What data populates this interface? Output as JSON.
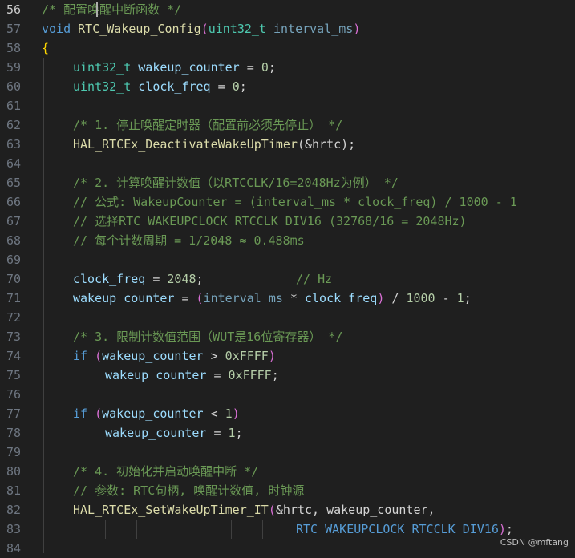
{
  "colors": {
    "background": "#1f1f1f",
    "line_number": "#6e7681",
    "comment": "#6a9955",
    "keyword": "#569cd6",
    "type": "#4ec9b0",
    "function": "#dcdcaa",
    "variable": "#9cdcfe",
    "number": "#b5cea8",
    "brace": "#ffd700",
    "paren": "#da70d6"
  },
  "line_numbers": [
    "56",
    "57",
    "58",
    "59",
    "60",
    "61",
    "62",
    "63",
    "64",
    "65",
    "66",
    "67",
    "68",
    "69",
    "70",
    "71",
    "72",
    "73",
    "74",
    "75",
    "76",
    "77",
    "78",
    "79",
    "80",
    "81",
    "82",
    "83",
    "84"
  ],
  "code": {
    "l56": {
      "comment": "/* 配置唤醒中断函数 */"
    },
    "l57": {
      "kw": "void",
      "fn": "RTC_Wakeup_Config",
      "open": "(",
      "type": "uint32_t",
      "param": "interval_ms",
      "close": ")"
    },
    "l58": {
      "brace": "{"
    },
    "l59": {
      "type": "uint32_t",
      "var": "wakeup_counter",
      "op": " = ",
      "num": "0",
      "end": ";"
    },
    "l60": {
      "type": "uint32_t",
      "var": "clock_freq",
      "op": " = ",
      "num": "0",
      "end": ";"
    },
    "l62": {
      "comment": "/* 1. 停止唤醒定时器（配置前必须先停止） */"
    },
    "l63": {
      "fn": "HAL_RTCEx_DeactivateWakeUpTimer",
      "args": "(&hrtc);"
    },
    "l65": {
      "comment": "/* 2. 计算唤醒计数值（以RTCCLK/16=2048Hz为例） */"
    },
    "l66": {
      "comment": "// 公式: WakeupCounter = (interval_ms * clock_freq) / 1000 - 1"
    },
    "l67": {
      "comment": "// 选择RTC_WAKEUPCLOCK_RTCCLK_DIV16 (32768/16 = 2048Hz)"
    },
    "l68": {
      "comment": "// 每个计数周期 = 1/2048 ≈ 0.488ms"
    },
    "l70": {
      "var": "clock_freq",
      "op": " = ",
      "num": "2048",
      "end": ";",
      "comment": "// Hz"
    },
    "l71": {
      "var": "wakeup_counter",
      "op": " = ",
      "open": "(",
      "param": "interval_ms",
      "op2": " * ",
      "var2": "clock_freq",
      "close": ")",
      "op3": " / ",
      "num": "1000",
      "op4": " - ",
      "num2": "1",
      "end": ";"
    },
    "l73": {
      "comment": "/* 3. 限制计数值范围（WUT是16位寄存器） */"
    },
    "l74": {
      "kw": "if",
      "open": "(",
      "var": "wakeup_counter",
      "op": " > ",
      "num": "0xFFFF",
      "close": ")"
    },
    "l75": {
      "var": "wakeup_counter",
      "op": " = ",
      "num": "0xFFFF",
      "end": ";"
    },
    "l77": {
      "kw": "if",
      "open": "(",
      "var": "wakeup_counter",
      "op": " < ",
      "num": "1",
      "close": ")"
    },
    "l78": {
      "var": "wakeup_counter",
      "op": " = ",
      "num": "1",
      "end": ";"
    },
    "l80": {
      "comment": "/* 4. 初始化并启动唤醒中断 */"
    },
    "l81": {
      "comment": "// 参数: RTC句柄, 唤醒计数值, 时钟源"
    },
    "l82": {
      "fn": "HAL_RTCEx_SetWakeUpTimer_IT",
      "open": "(",
      "args": "&hrtc, wakeup_counter,",
      "var": "wakeup_counter"
    },
    "l83": {
      "macro": "RTC_WAKEUPCLOCK_RTCCLK_DIV16",
      "close": ")",
      "end": ";"
    }
  },
  "watermark": "CSDN @mftang"
}
